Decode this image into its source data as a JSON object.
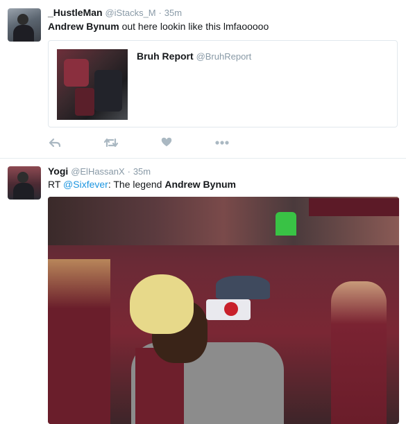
{
  "tweets": [
    {
      "name": "_HustleMan",
      "handle": "@iStacks_M",
      "separator": "·",
      "time": "35m",
      "text_bold": "Andrew Bynum",
      "text_rest": " out here lookin like this lmfaooooo",
      "quote": {
        "name": "Bruh Report",
        "handle": "@BruhReport"
      },
      "actions": [
        "reply-icon",
        "retweet-icon",
        "like-icon",
        "more-icon"
      ]
    },
    {
      "name": "Yogi",
      "handle": "@ElHassanX",
      "separator": "·",
      "time": "35m",
      "text_prefix": "RT ",
      "text_mention": "@Sixfever",
      "text_middle": ": The legend ",
      "text_bold": "Andrew Bynum"
    }
  ],
  "colors": {
    "link": "#1b95e0",
    "muted": "#8899a6",
    "icon": "#aab8c2",
    "divider": "#e6ecf0"
  }
}
